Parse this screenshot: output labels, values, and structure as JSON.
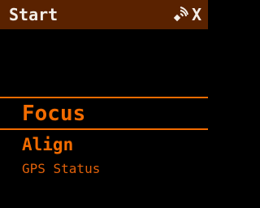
{
  "header": {
    "title": "Start",
    "close_label": "X",
    "signal_icon": "satellite-signal-icon"
  },
  "menu": {
    "items": [
      {
        "label": "Focus",
        "state": "selected"
      },
      {
        "label": "Align",
        "state": "next"
      },
      {
        "label": "GPS Status",
        "state": "normal"
      }
    ]
  },
  "colors": {
    "background": "#000000",
    "header_background": "#5a2200",
    "header_text": "#f3eee8",
    "accent": "#f26b00"
  }
}
